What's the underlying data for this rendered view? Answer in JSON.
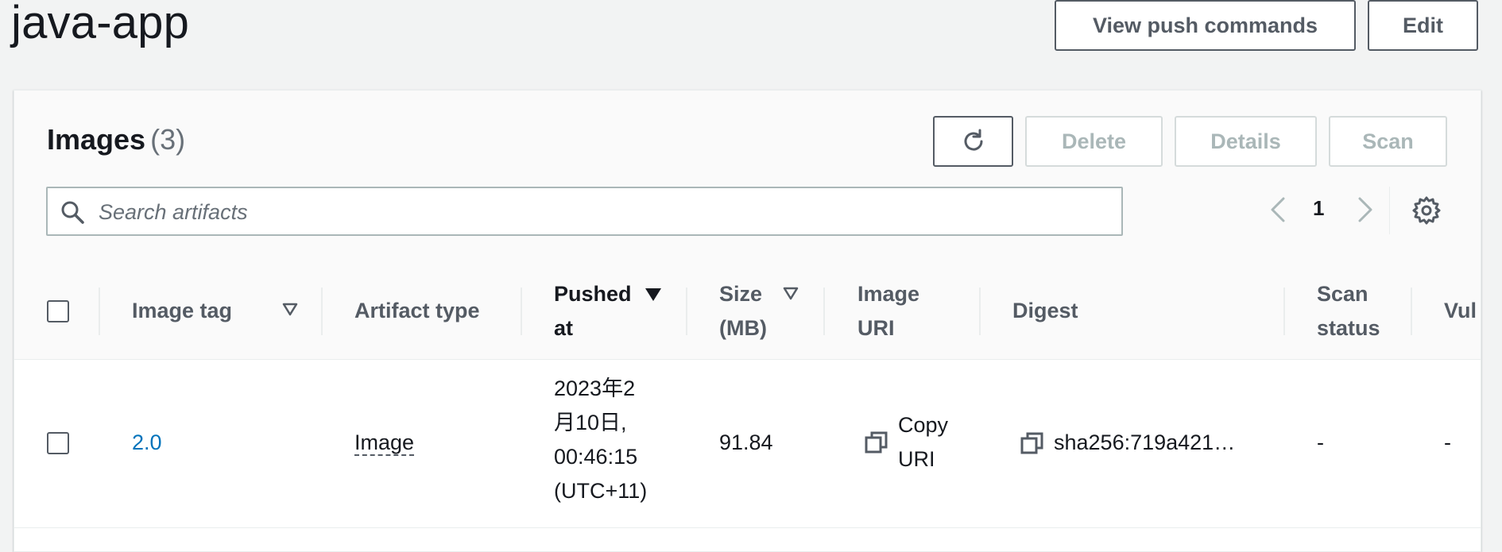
{
  "header": {
    "title": "java-app",
    "view_push_label": "View push commands",
    "edit_label": "Edit"
  },
  "images_panel": {
    "title": "Images",
    "count": "(3)",
    "actions": {
      "delete": "Delete",
      "details": "Details",
      "scan": "Scan"
    },
    "search": {
      "placeholder": "Search artifacts",
      "value": ""
    },
    "pagination": {
      "current_page": "1"
    }
  },
  "table": {
    "columns": {
      "image_tag": "Image tag",
      "artifact_type": "Artifact type",
      "pushed_at_1": "Pushed",
      "pushed_at_2": "at",
      "size_1": "Size",
      "size_2": "(MB)",
      "image_uri_1": "Image",
      "image_uri_2": "URI",
      "digest": "Digest",
      "scan_status_1": "Scan",
      "scan_status_2": "status",
      "vulnerabilities": "Vul"
    },
    "rows": [
      {
        "image_tag": "2.0",
        "artifact_type": "Image",
        "pushed_at": [
          "2023年2",
          "月10日,",
          "00:46:15",
          "(UTC+11)"
        ],
        "size": "91.84",
        "copy_uri_1": "Copy",
        "copy_uri_2": "URI",
        "digest": "sha256:719a421…",
        "scan_status": "-",
        "vulnerabilities": "-"
      }
    ]
  },
  "icons": [
    "refresh-icon",
    "search-icon",
    "chevron-left-icon",
    "chevron-right-icon",
    "settings-gear-icon",
    "sort-caret-icon",
    "copy-icon"
  ],
  "colors": {
    "link": "#0073bb",
    "text": "#16191f",
    "muted": "#545b64",
    "disabled": "#aab7b8"
  }
}
